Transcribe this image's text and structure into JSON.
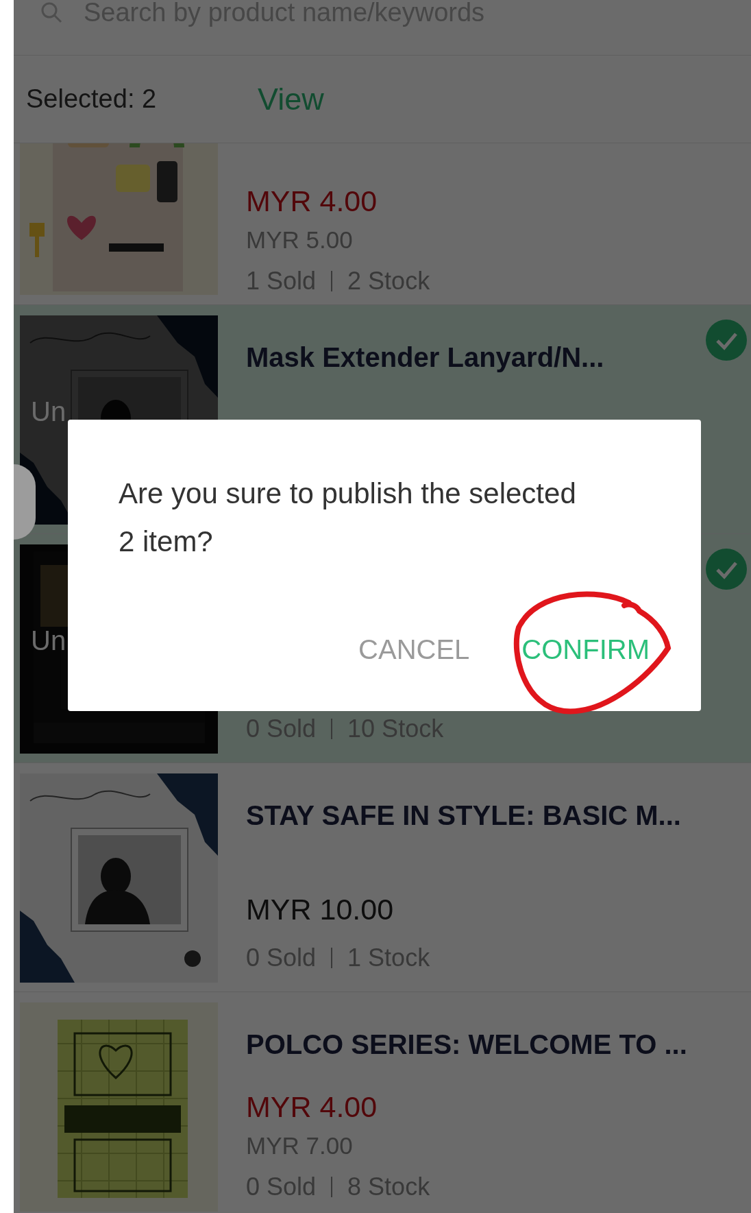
{
  "search": {
    "placeholder": "Search by product name/keywords"
  },
  "selection_bar": {
    "count_label": "Selected: 2",
    "view_link": "View"
  },
  "products": [
    {
      "selected": false,
      "price": "MYR 4.00",
      "original_price": "MYR 5.00",
      "sold": "1 Sold",
      "stock": "2 Stock"
    },
    {
      "selected": true,
      "title": "Mask Extender Lanyard/N...",
      "status_label": "Un"
    },
    {
      "selected": true,
      "status_label": "Un",
      "sold": "0 Sold",
      "stock": "10 Stock"
    },
    {
      "selected": false,
      "title": "STAY SAFE IN STYLE: BASIC M...",
      "price": "MYR 10.00",
      "sold": "0 Sold",
      "stock": "1 Stock"
    },
    {
      "selected": false,
      "title": "POLCO SERIES: WELCOME TO ...",
      "price": "MYR 4.00",
      "original_price": "MYR 7.00",
      "sold": "0 Sold",
      "stock": "8 Stock"
    }
  ],
  "dialog": {
    "message": "Are you sure to publish the selected 2 item?",
    "buttons": [
      {
        "label": "CANCEL",
        "kind": "secondary",
        "annotated": false
      },
      {
        "label": "CONFIRM",
        "kind": "primary",
        "annotated": true
      }
    ]
  }
}
